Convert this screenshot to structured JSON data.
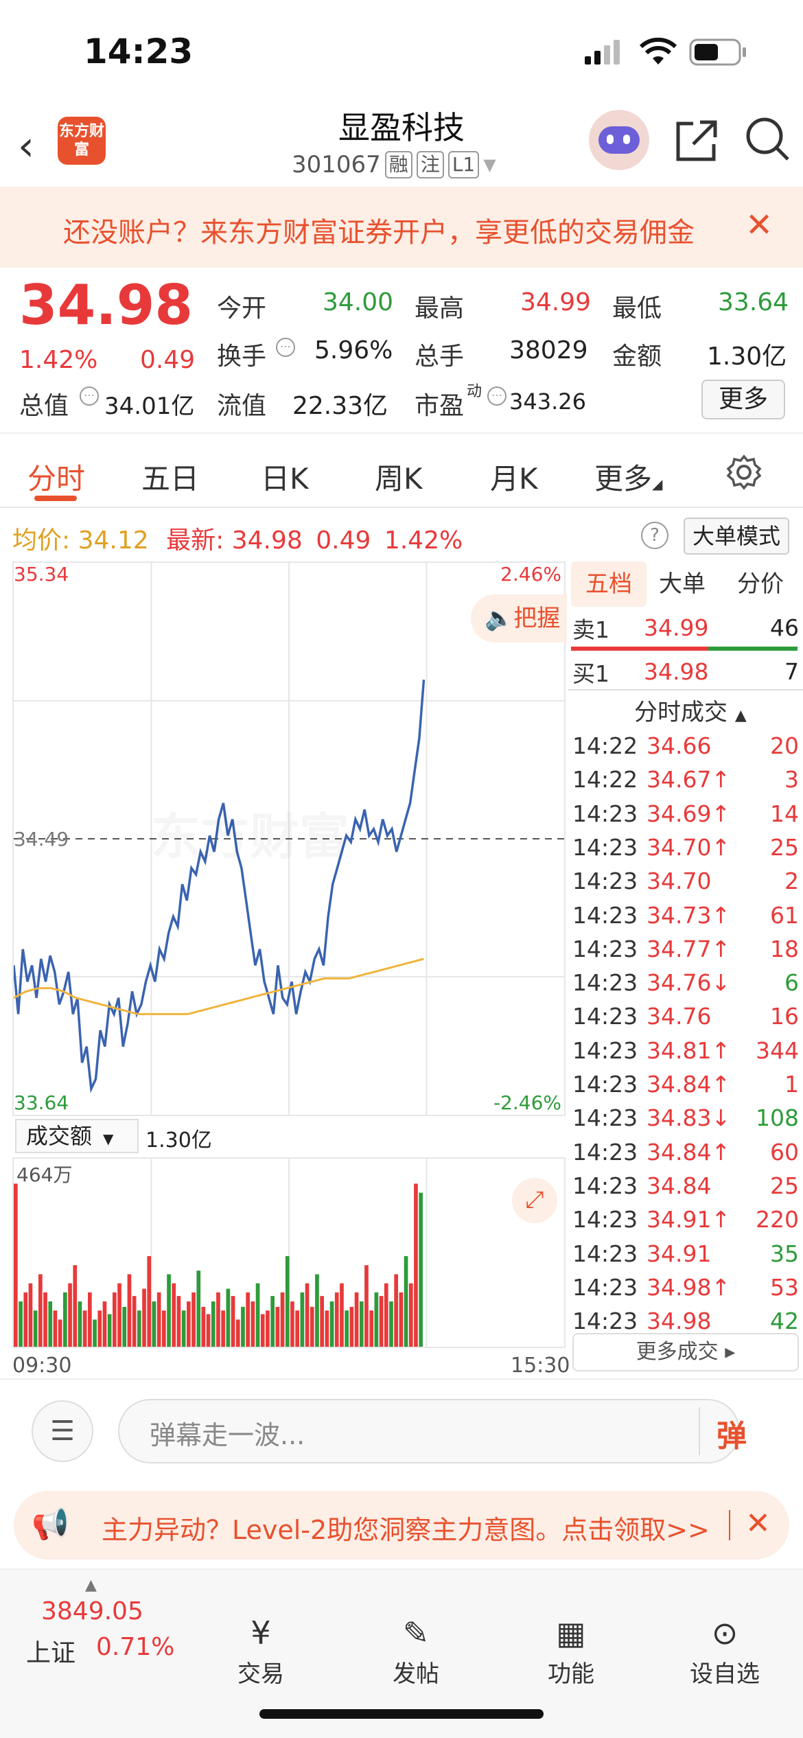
{
  "status_bar": {
    "time": "14:23"
  },
  "header": {
    "logo_text": "东方财富",
    "title": "显盈科技",
    "code": "301067",
    "tags": [
      "融",
      "注",
      "L1"
    ]
  },
  "banner": {
    "text": "还没账户？来东方财富证券开户，享更低的交易佣金"
  },
  "quote": {
    "price": "34.98",
    "change_pct": "1.42%",
    "change": "0.49",
    "total_value_label": "总值",
    "total_value": "34.01亿",
    "open_label": "今开",
    "open": "34.00",
    "high_label": "最高",
    "high": "34.99",
    "low_label": "最低",
    "low": "33.64",
    "turnover_label": "换手",
    "turnover": "5.96%",
    "volume_label": "总手",
    "volume": "38029",
    "amount_label": "金额",
    "amount": "1.30亿",
    "float_label": "流值",
    "float_value": "22.33亿",
    "pe_label": "市盈",
    "pe_sup": "动",
    "pe": "343.26",
    "more_label": "更多"
  },
  "tabs": [
    "分时",
    "五日",
    "日K",
    "周K",
    "月K",
    "更多"
  ],
  "price_info": {
    "avg_label": "均价:",
    "avg": "34.12",
    "last_label": "最新:",
    "last": "34.98",
    "chg": "0.49",
    "pct": "1.42%",
    "mode_label": "大单模式"
  },
  "chart_data": {
    "type": "line",
    "title": "",
    "y_top_label": "35.34",
    "y_mid_label": "34.49",
    "y_bottom_label": "33.64",
    "pct_top": "2.46%",
    "pct_bottom": "-2.46%",
    "ylim": [
      33.64,
      35.34
    ],
    "x_start": "09:30",
    "x_end": "15:30",
    "watermark": "东方财富",
    "badge": "把握",
    "series": [
      {
        "name": "最新",
        "color": "#3a63b0",
        "values": [
          34.1,
          33.95,
          34.15,
          34.05,
          34.1,
          34.0,
          34.12,
          34.05,
          34.13,
          34.08,
          33.98,
          34.02,
          34.08,
          33.95,
          34.0,
          33.8,
          33.85,
          33.72,
          33.75,
          33.9,
          33.85,
          33.98,
          33.95,
          34.0,
          33.85,
          33.92,
          34.02,
          33.95,
          33.98,
          34.05,
          34.1,
          34.05,
          34.15,
          34.12,
          34.2,
          34.25,
          34.22,
          34.35,
          34.3,
          34.4,
          34.38,
          34.45,
          34.42,
          34.5,
          34.45,
          34.55,
          34.6,
          34.5,
          34.55,
          34.45,
          34.4,
          34.3,
          34.2,
          34.1,
          34.15,
          34.05,
          34.0,
          33.95,
          34.1,
          34.0,
          33.98,
          34.05,
          33.95,
          34.02,
          34.08,
          34.05,
          34.12,
          34.15,
          34.1,
          34.25,
          34.35,
          34.4,
          34.45,
          34.5,
          34.48,
          34.55,
          34.52,
          34.58,
          34.5,
          34.52,
          34.48,
          34.55,
          34.5,
          34.52,
          34.45,
          34.5,
          34.55,
          34.6,
          34.7,
          34.8,
          34.98
        ]
      },
      {
        "name": "均价",
        "color": "#f0b43c",
        "values": [
          34.0,
          34.02,
          34.03,
          34.03,
          34.02,
          34.0,
          33.99,
          33.98,
          33.97,
          33.96,
          33.95,
          33.95,
          33.95,
          33.95,
          33.95,
          33.96,
          33.97,
          33.98,
          33.99,
          34.0,
          34.01,
          34.02,
          34.03,
          34.04,
          34.05,
          34.06,
          34.06,
          34.06,
          34.07,
          34.08,
          34.09,
          34.1,
          34.11,
          34.12
        ]
      }
    ]
  },
  "volume": {
    "label": "成交额",
    "amount": "1.30亿",
    "max_label": "464万",
    "bars": [
      0.9,
      0.25,
      0.3,
      0.35,
      0.2,
      0.4,
      0.3,
      0.25,
      0.2,
      0.15,
      0.3,
      0.35,
      0.45,
      0.25,
      0.2,
      0.3,
      0.15,
      0.2,
      0.25,
      0.18,
      0.3,
      0.35,
      0.22,
      0.4,
      0.28,
      0.2,
      0.32,
      0.5,
      0.25,
      0.3,
      0.2,
      0.4,
      0.35,
      0.28,
      0.2,
      0.25,
      0.3,
      0.42,
      0.22,
      0.18,
      0.25,
      0.3,
      0.2,
      0.32,
      0.28,
      0.15,
      0.22,
      0.3,
      0.25,
      0.35,
      0.18,
      0.2,
      0.28,
      0.22,
      0.3,
      0.5,
      0.25,
      0.2,
      0.3,
      0.35,
      0.22,
      0.4,
      0.28,
      0.2,
      0.25,
      0.3,
      0.35,
      0.2,
      0.22,
      0.3,
      0.25,
      0.45,
      0.2,
      0.3,
      0.28,
      0.35,
      0.25,
      0.4,
      0.3,
      0.5,
      0.35,
      0.9,
      0.85
    ]
  },
  "order_book": {
    "tabs": [
      "五档",
      "大单",
      "分价"
    ],
    "sell1": {
      "label": "卖1",
      "price": "34.99",
      "vol": "46"
    },
    "buy1": {
      "label": "买1",
      "price": "34.98",
      "vol": "7"
    },
    "ticks_title": "分时成交",
    "ticks": [
      {
        "t": "14:22",
        "p": "34.66",
        "v": "20",
        "dir": "",
        "pc": "red",
        "vc": "red"
      },
      {
        "t": "14:22",
        "p": "34.67↑",
        "v": "3",
        "dir": "up",
        "pc": "red",
        "vc": "red"
      },
      {
        "t": "14:23",
        "p": "34.69↑",
        "v": "14",
        "dir": "up",
        "pc": "red",
        "vc": "red"
      },
      {
        "t": "14:23",
        "p": "34.70↑",
        "v": "25",
        "dir": "up",
        "pc": "red",
        "vc": "red"
      },
      {
        "t": "14:23",
        "p": "34.70",
        "v": "2",
        "dir": "",
        "pc": "red",
        "vc": "red"
      },
      {
        "t": "14:23",
        "p": "34.73↑",
        "v": "61",
        "dir": "up",
        "pc": "red",
        "vc": "red"
      },
      {
        "t": "14:23",
        "p": "34.77↑",
        "v": "18",
        "dir": "up",
        "pc": "red",
        "vc": "red"
      },
      {
        "t": "14:23",
        "p": "34.76↓",
        "v": "6",
        "dir": "down",
        "pc": "red",
        "vc": "green"
      },
      {
        "t": "14:23",
        "p": "34.76",
        "v": "16",
        "dir": "",
        "pc": "red",
        "vc": "red"
      },
      {
        "t": "14:23",
        "p": "34.81↑",
        "v": "344",
        "dir": "up",
        "pc": "red",
        "vc": "red"
      },
      {
        "t": "14:23",
        "p": "34.84↑",
        "v": "1",
        "dir": "up",
        "pc": "red",
        "vc": "red"
      },
      {
        "t": "14:23",
        "p": "34.83↓",
        "v": "108",
        "dir": "down",
        "pc": "red",
        "vc": "green"
      },
      {
        "t": "14:23",
        "p": "34.84↑",
        "v": "60",
        "dir": "up",
        "pc": "red",
        "vc": "red"
      },
      {
        "t": "14:23",
        "p": "34.84",
        "v": "25",
        "dir": "",
        "pc": "red",
        "vc": "red"
      },
      {
        "t": "14:23",
        "p": "34.91↑",
        "v": "220",
        "dir": "up",
        "pc": "red",
        "vc": "red"
      },
      {
        "t": "14:23",
        "p": "34.91",
        "v": "35",
        "dir": "",
        "pc": "red",
        "vc": "green"
      },
      {
        "t": "14:23",
        "p": "34.98↑",
        "v": "53",
        "dir": "up",
        "pc": "red",
        "vc": "red"
      },
      {
        "t": "14:23",
        "p": "34.98",
        "v": "42",
        "dir": "",
        "pc": "red",
        "vc": "green"
      }
    ],
    "more_ticks": "更多成交"
  },
  "danmu": {
    "placeholder": "弹幕走一波...",
    "send_label": "弹"
  },
  "promo": {
    "text": "主力异动？Level-2助您洞察主力意图。点击领取>>"
  },
  "nav": {
    "index_value": "3849.05",
    "index_name": "上证",
    "index_pct": "0.71%",
    "items": [
      "交易",
      "发帖",
      "功能",
      "设自选"
    ]
  },
  "colors": {
    "up": "#e8393a",
    "down": "#2d9b3a",
    "accent": "#e8512d",
    "price_line": "#3a63b0",
    "avg_line": "#f0b43c"
  }
}
